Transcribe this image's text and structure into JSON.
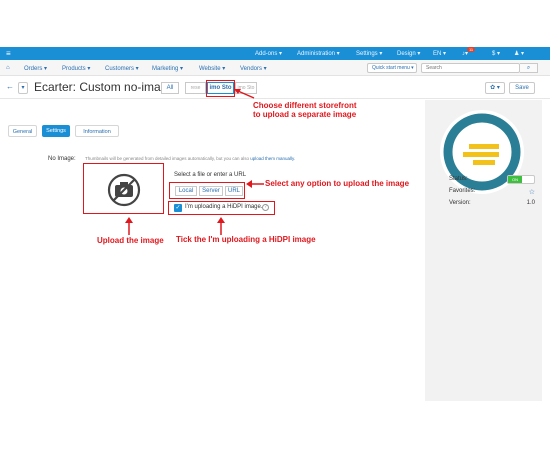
{
  "topbar": {
    "menu_icon": "hamburger-icon",
    "addons": "Add-ons ▾",
    "administration": "Administration ▾",
    "settings": "Settings ▾",
    "design": "Design ▾",
    "language": "EN ▾",
    "notifications_count": "11",
    "currency": "$ ▾",
    "user_icon": "user-icon"
  },
  "nav": {
    "home_icon": "home-icon",
    "orders": "Orders ▾",
    "products": "Products ▾",
    "customers": "Customers ▾",
    "marketing": "Marketing ▾",
    "website": "Website ▾",
    "vendors": "Vendors ▾",
    "quick_start": "Quick start menu ▾",
    "search_placeholder": "Search"
  },
  "header": {
    "back": "←",
    "dropdown": "▾",
    "title": "Ecarter: Custom no-image",
    "storefront_all": "All",
    "storefront_prev": "rese",
    "storefront_active": "imo Sto",
    "storefront_next": "imo Sto",
    "gear": "✿ ▾",
    "save": "Save"
  },
  "tabs": {
    "general": "General",
    "settings": "Settings",
    "information": "Information"
  },
  "form": {
    "no_image_label": "No Image:",
    "hint_text": "Thumbnails will be generated from detailed images automatically, but you can also ",
    "hint_link": "upload them manually.",
    "select_text": "Select a file or enter a URL",
    "local": "Local",
    "server": "Server",
    "url": "URL",
    "hidpi_label": "I'm uploading a HiDPI image.",
    "question_icon": "?"
  },
  "annotations": {
    "storefront_note_1": "Choose different storefront",
    "storefront_note_2": "to upload a separate image",
    "select_option": "Select any option to upload the image",
    "upload": "Upload the image",
    "tick": "Tick the I'm uploading a HiDPI image"
  },
  "sidebar": {
    "status_label": "Status:",
    "status_value": "ON",
    "favorites_label": "Favorites:",
    "favorites_value": "☆",
    "version_label": "Version:",
    "version_value": "1.0"
  },
  "colors": {
    "topbar": "#1a8fd6",
    "annotation": "#e0181e",
    "logo_teal": "#2a7f96",
    "logo_yellow": "#f2c21b"
  }
}
